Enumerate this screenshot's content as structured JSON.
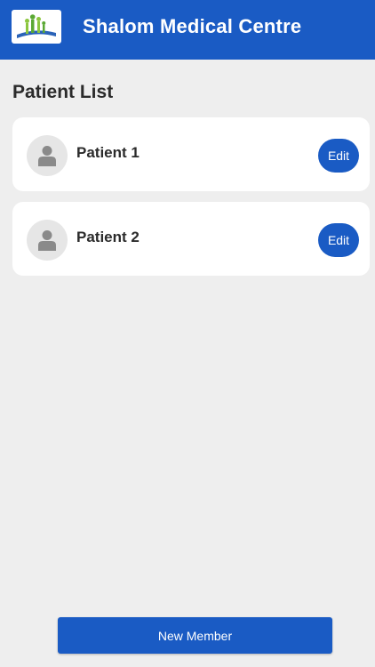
{
  "header": {
    "title": "Shalom Medical Centre",
    "logo_icon": "family-logo-icon"
  },
  "main": {
    "section_title": "Patient List",
    "patients": [
      {
        "name": "Patient 1",
        "edit_label": "Edit",
        "avatar_icon": "person-icon"
      },
      {
        "name": "Patient 2",
        "edit_label": "Edit",
        "avatar_icon": "person-icon"
      }
    ]
  },
  "footer": {
    "new_member_label": "New Member"
  },
  "colors": {
    "primary": "#1a5bc4",
    "background": "#eeeeee",
    "card": "#ffffff",
    "avatar_bg": "#e6e6e6",
    "avatar_icon": "#8a8a8a"
  }
}
